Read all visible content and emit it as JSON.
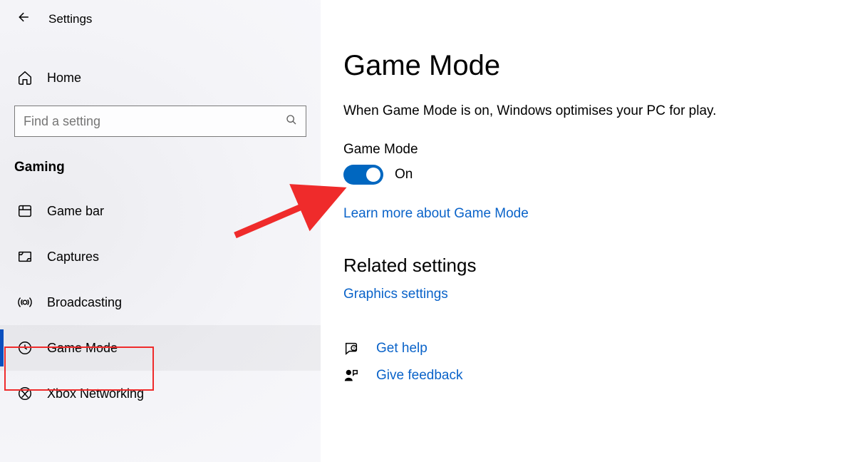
{
  "header": {
    "app_title": "Settings"
  },
  "sidebar": {
    "home_label": "Home",
    "search_placeholder": "Find a setting",
    "section_label": "Gaming",
    "items": [
      {
        "label": "Game bar"
      },
      {
        "label": "Captures"
      },
      {
        "label": "Broadcasting"
      },
      {
        "label": "Game Mode",
        "selected": true
      },
      {
        "label": "Xbox Networking"
      }
    ]
  },
  "main": {
    "title": "Game Mode",
    "description": "When Game Mode is on, Windows optimises your PC for play.",
    "toggle_label": "Game Mode",
    "toggle_state": "On",
    "learn_more": "Learn more about Game Mode",
    "related_heading": "Related settings",
    "graphics_link": "Graphics settings",
    "get_help": "Get help",
    "give_feedback": "Give feedback"
  },
  "colors": {
    "accent": "#0067c0",
    "link": "#0a63c9",
    "annotation": "#ef2b2b"
  }
}
